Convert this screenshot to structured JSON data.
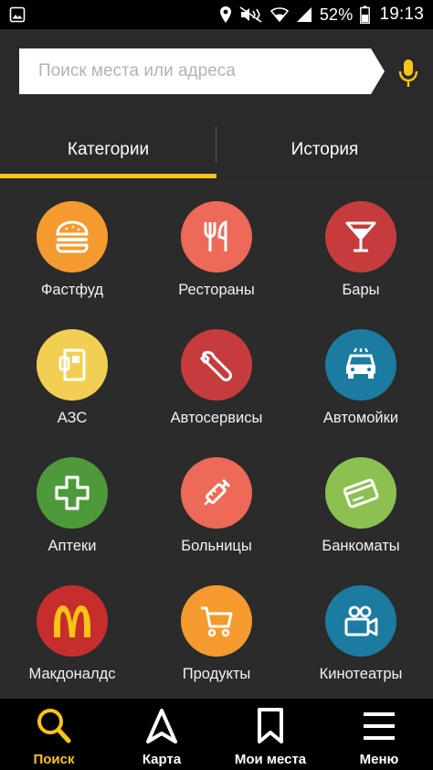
{
  "status_bar": {
    "battery_percent": "52%",
    "time": "19:13"
  },
  "search": {
    "placeholder": "Поиск места или адреса",
    "value": ""
  },
  "tabs": [
    {
      "label": "Категории",
      "active": true
    },
    {
      "label": "История",
      "active": false
    }
  ],
  "categories": [
    {
      "label": "Фастфуд",
      "icon": "burger-icon",
      "color": "#f59a2e"
    },
    {
      "label": "Рестораны",
      "icon": "fork-knife-icon",
      "color": "#ec6a57"
    },
    {
      "label": "Бары",
      "icon": "cocktail-glass-icon",
      "color": "#c63c3c"
    },
    {
      "label": "АЗС",
      "icon": "fuel-pump-icon",
      "color": "#f2cf53"
    },
    {
      "label": "Автосервисы",
      "icon": "wrench-icon",
      "color": "#c63c3c"
    },
    {
      "label": "Автомойки",
      "icon": "car-wash-icon",
      "color": "#1b7ba0"
    },
    {
      "label": "Аптеки",
      "icon": "medical-cross-icon",
      "color": "#4e9a3a"
    },
    {
      "label": "Больницы",
      "icon": "syringe-icon",
      "color": "#ec6a57"
    },
    {
      "label": "Банкоматы",
      "icon": "card-icon",
      "color": "#8cc152"
    },
    {
      "label": "Макдоналдс",
      "icon": "mcdonalds-logo-icon",
      "color": "#c62d2d"
    },
    {
      "label": "Продукты",
      "icon": "shopping-cart-icon",
      "color": "#f59a2e"
    },
    {
      "label": "Кинотеатры",
      "icon": "movie-camera-icon",
      "color": "#1b7ba0"
    }
  ],
  "bottom_nav": [
    {
      "label": "Поиск",
      "icon": "search-icon",
      "active": true
    },
    {
      "label": "Карта",
      "icon": "navigation-arrow-icon",
      "active": false
    },
    {
      "label": "Мои места",
      "icon": "bookmark-icon",
      "active": false
    },
    {
      "label": "Меню",
      "icon": "menu-icon",
      "active": false
    }
  ],
  "colors": {
    "accent": "#f9c413",
    "background": "#2b2b2b"
  }
}
